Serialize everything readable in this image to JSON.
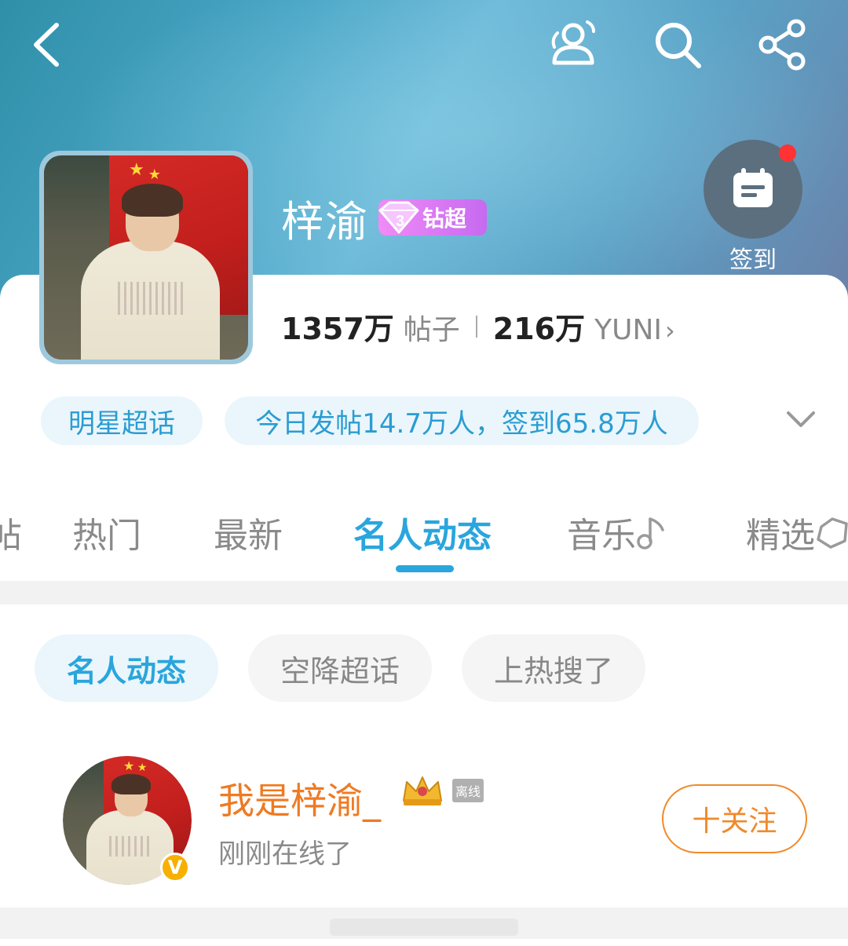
{
  "header": {
    "group_name": "梓渝",
    "tier_label": "钻超",
    "checkin_label": "签到"
  },
  "stats": {
    "posts_count": "1357万",
    "posts_unit": "帖子",
    "members_count": "216万",
    "members_unit": "YUNI",
    "chevron": "›"
  },
  "tags": {
    "category": "明星超话",
    "today": "今日发帖14.7万人，签到65.8万人"
  },
  "tabs": [
    {
      "label": "帖"
    },
    {
      "label": "热门"
    },
    {
      "label": "最新"
    },
    {
      "label": "名人动态"
    },
    {
      "label": "音乐"
    },
    {
      "label": "精选"
    }
  ],
  "active_tab": "名人动态",
  "chips": [
    {
      "label": "名人动态"
    },
    {
      "label": "空降超话"
    },
    {
      "label": "上热搜了"
    }
  ],
  "member": {
    "name": "我是梓渝_",
    "offline_label": "离线",
    "status": "刚刚在线了",
    "verify_mark": "V",
    "follow_label": "十关注"
  },
  "colors": {
    "accent": "#2aa5dd",
    "name_orange": "#ef7a22",
    "follow_orange": "#ef8a2a",
    "tier_purple": "#d176f3"
  }
}
